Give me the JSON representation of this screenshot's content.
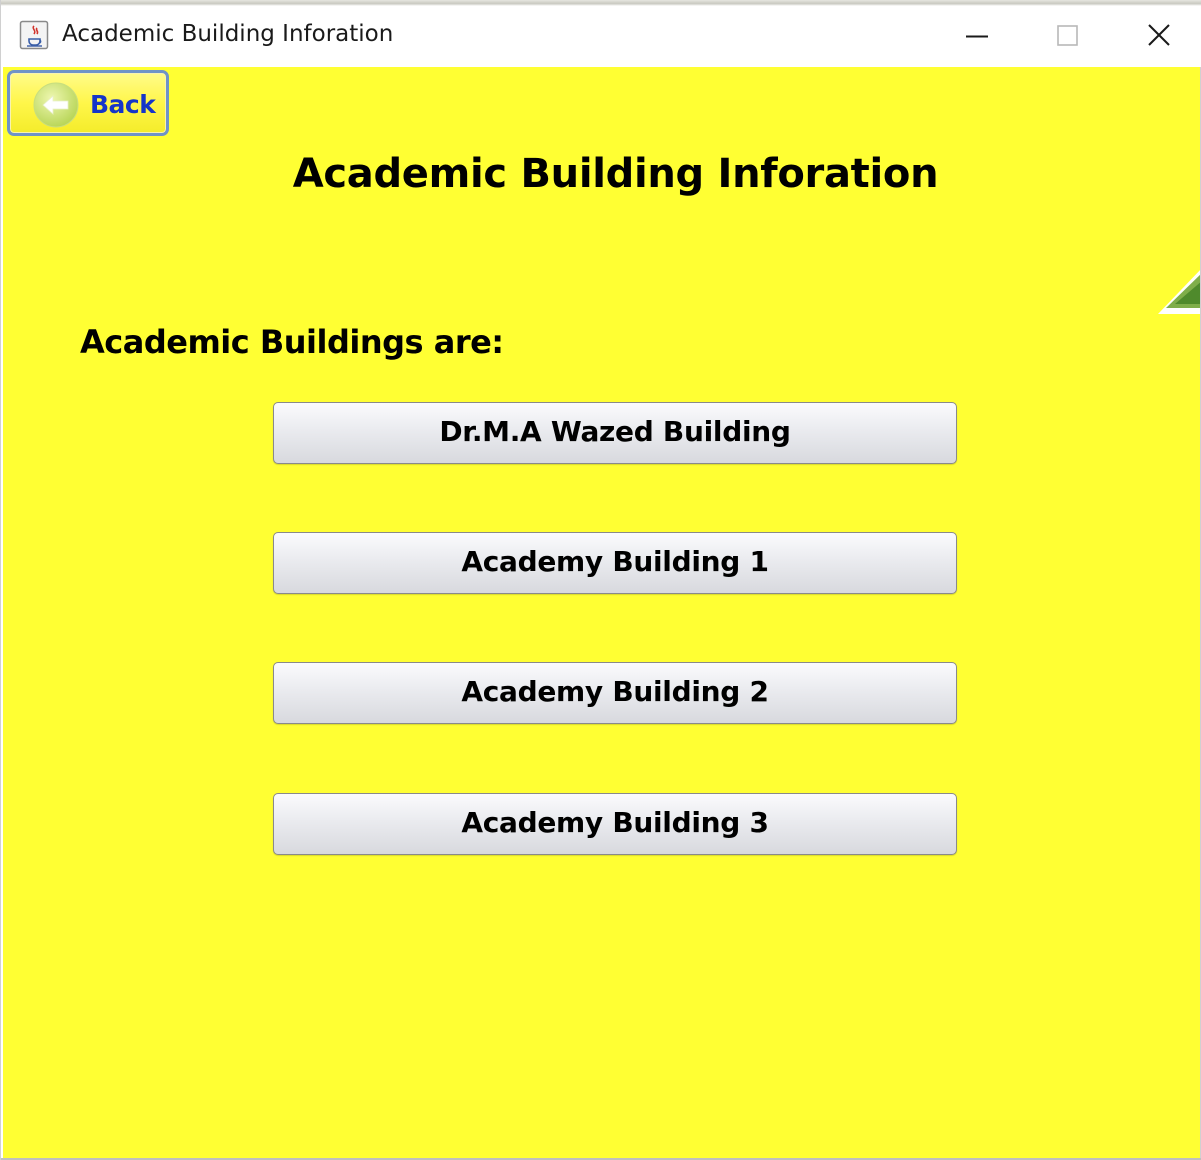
{
  "window": {
    "title": "Academic Building Inforation",
    "icon": "java-cup-icon",
    "controls": {
      "minimize_icon": "minimize-icon",
      "maximize_icon": "maximize-icon",
      "close_icon": "close-icon"
    }
  },
  "header": {
    "back_label": "Back",
    "back_icon": "arrow-left-icon",
    "page_title": "Academic Building Inforation"
  },
  "main": {
    "section_label": "Academic Buildings are:",
    "buildings": [
      {
        "label": "Dr.M.A Wazed Building"
      },
      {
        "label": "Academy Building 1"
      },
      {
        "label": "Academy Building 2"
      },
      {
        "label": "Academy Building 3"
      }
    ]
  },
  "colors": {
    "background": "#ffff33",
    "back_text": "#1535c9",
    "back_border": "#6f93c7",
    "button_face": "#eaebef",
    "text": "#000000"
  }
}
